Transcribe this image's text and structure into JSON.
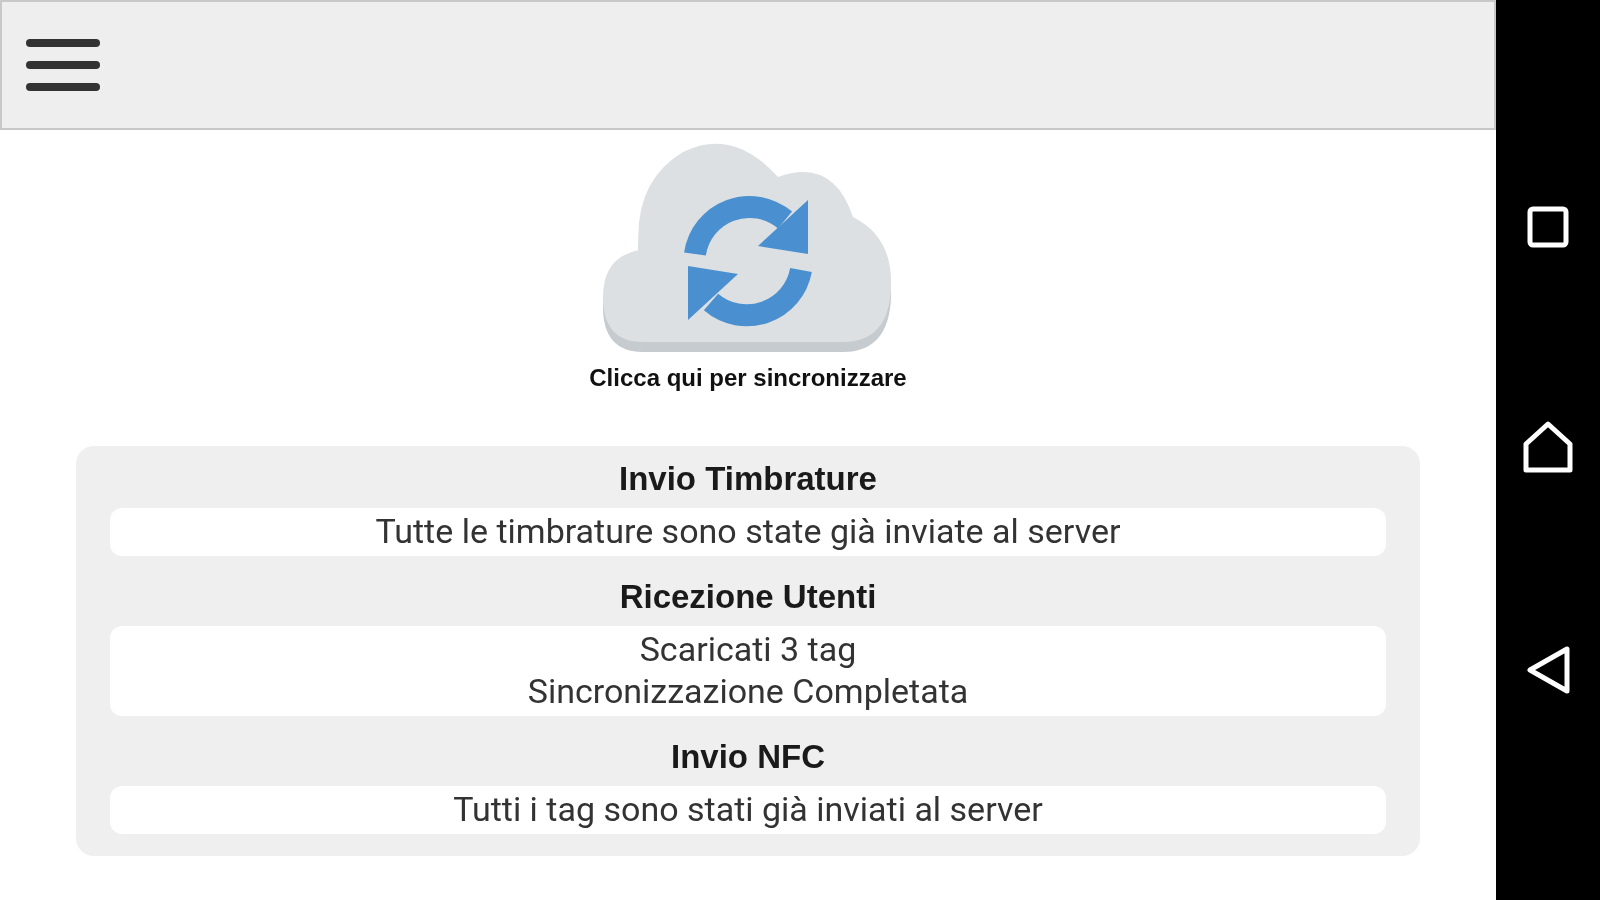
{
  "sync_button": {
    "label": "Clicca qui per sincronizzare"
  },
  "sections": [
    {
      "title": "Invio Timbrature",
      "lines": [
        "Tutte le timbrature sono state già inviate al server"
      ]
    },
    {
      "title": "Ricezione Utenti",
      "lines": [
        "Scaricati 3 tag",
        "Sincronizzazione Completata"
      ]
    },
    {
      "title": "Invio NFC",
      "lines": [
        "Tutti i tag sono stati già inviati al server"
      ]
    }
  ]
}
